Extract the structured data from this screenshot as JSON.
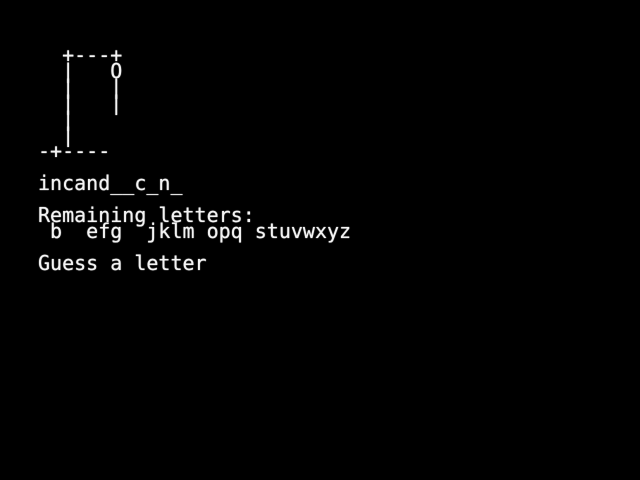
{
  "gallows": [
    "  +---+",
    "  |   O",
    "  |   |",
    "  |   |",
    "  |",
    "  |",
    "-+----"
  ],
  "word_progress": "incand__c_n_",
  "remaining_label": "Remaining letters:",
  "remaining_letters": " b  efg  jklm opq stuvwxyz",
  "prompt": "Guess a letter",
  "colors": {
    "background": "#000000",
    "text": "#f4f4f4"
  }
}
